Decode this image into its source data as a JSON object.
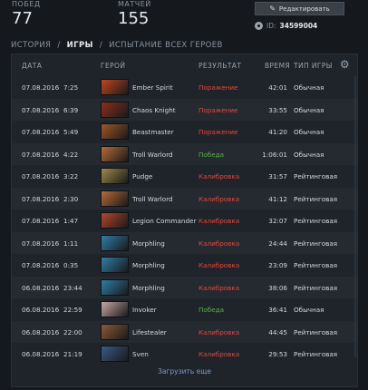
{
  "stats": {
    "wins_label": "ПОБЕД",
    "wins_value": "77",
    "matches_label": "МАТЧЕЙ",
    "matches_value": "155"
  },
  "profile": {
    "edit_label": "Редактировать",
    "id_label": "ID:",
    "id_value": "34599004"
  },
  "breadcrumb": {
    "history": "ИСТОРИЯ",
    "sep1": "/",
    "games": "ИГРЫ",
    "sep2": "/",
    "trial": "ИСПЫТАНИЕ ВСЕХ ГЕРОЕВ"
  },
  "table": {
    "headers": {
      "date": "ДАТА",
      "hero": "ГЕРОЙ",
      "result": "РЕЗУЛЬТАТ",
      "time": "ВРЕМЯ",
      "type": "ТИП ИГРЫ"
    },
    "rows": [
      {
        "date": "07.08.2016",
        "clock": "7:25",
        "hero": "Ember Spirit",
        "result": "Поражение",
        "result_kind": "loss",
        "duration": "42:01",
        "type": "Обычная",
        "hero_color": "#c2441e"
      },
      {
        "date": "07.08.2016",
        "clock": "6:39",
        "hero": "Chaos Knight",
        "result": "Поражение",
        "result_kind": "loss",
        "duration": "33:55",
        "type": "Обычная",
        "hero_color": "#8a2f1c"
      },
      {
        "date": "07.08.2016",
        "clock": "5:49",
        "hero": "Beastmaster",
        "result": "Поражение",
        "result_kind": "loss",
        "duration": "41:20",
        "type": "Обычная",
        "hero_color": "#a0572a"
      },
      {
        "date": "07.08.2016",
        "clock": "4:22",
        "hero": "Troll Warlord",
        "result": "Победа",
        "result_kind": "win",
        "duration": "1:06:01",
        "type": "Обычная",
        "hero_color": "#b86a38"
      },
      {
        "date": "07.08.2016",
        "clock": "3:22",
        "hero": "Pudge",
        "result": "Калибровка",
        "result_kind": "calib",
        "duration": "31:57",
        "type": "Рейтинговая",
        "hero_color": "#9e8a4a"
      },
      {
        "date": "07.08.2016",
        "clock": "2:30",
        "hero": "Troll Warlord",
        "result": "Калибровка",
        "result_kind": "calib",
        "duration": "41:12",
        "type": "Рейтинговая",
        "hero_color": "#b86a38"
      },
      {
        "date": "07.08.2016",
        "clock": "1:47",
        "hero": "Legion Commander",
        "result": "Калибровка",
        "result_kind": "calib",
        "duration": "32:07",
        "type": "Рейтинговая",
        "hero_color": "#b8452c"
      },
      {
        "date": "07.08.2016",
        "clock": "1:11",
        "hero": "Morphling",
        "result": "Калибровка",
        "result_kind": "calib",
        "duration": "24:44",
        "type": "Рейтинговая",
        "hero_color": "#2f7ea8"
      },
      {
        "date": "07.08.2016",
        "clock": "0:35",
        "hero": "Morphling",
        "result": "Калибровка",
        "result_kind": "calib",
        "duration": "23:09",
        "type": "Рейтинговая",
        "hero_color": "#2f7ea8"
      },
      {
        "date": "06.08.2016",
        "clock": "23:44",
        "hero": "Morphling",
        "result": "Калибровка",
        "result_kind": "calib",
        "duration": "38:06",
        "type": "Рейтинговая",
        "hero_color": "#2f7ea8"
      },
      {
        "date": "06.08.2016",
        "clock": "22:59",
        "hero": "Invoker",
        "result": "Победа",
        "result_kind": "win",
        "duration": "36:41",
        "type": "Обычная",
        "hero_color": "#c9a6a6"
      },
      {
        "date": "06.08.2016",
        "clock": "22:00",
        "hero": "Lifestealer",
        "result": "Калибровка",
        "result_kind": "calib",
        "duration": "44:45",
        "type": "Рейтинговая",
        "hero_color": "#8a5a3a"
      },
      {
        "date": "06.08.2016",
        "clock": "21:19",
        "hero": "Sven",
        "result": "Калибровка",
        "result_kind": "calib",
        "duration": "29:53",
        "type": "Рейтинговая",
        "hero_color": "#3a5a86"
      }
    ],
    "load_more": "Загрузить еще"
  },
  "colors": {
    "loss": "#e2463c",
    "win": "#59b14a",
    "link": "#7a9cc4"
  }
}
